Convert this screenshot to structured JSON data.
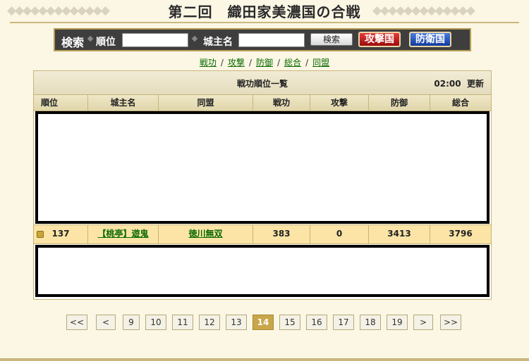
{
  "page": {
    "title": "第二回　織田家美濃国の合戦"
  },
  "search": {
    "heading": "検索",
    "rank_label": "順位",
    "rank_value": "",
    "lord_label": "城主名",
    "lord_value": "",
    "search_button": "検索",
    "attack_country": "攻撃国",
    "defense_country": "防衛国"
  },
  "categories": {
    "items": [
      "戦功",
      "攻撃",
      "防御",
      "総合",
      "同盟"
    ],
    "separator": "/"
  },
  "table": {
    "title": "戦功順位一覧",
    "time": "02:00",
    "refresh": "更新",
    "columns": [
      "順位",
      "城主名",
      "同盟",
      "戦功",
      "攻撃",
      "防御",
      "総合"
    ],
    "highlight_row": {
      "rank": "137",
      "lord": "【桃亭】遊鬼",
      "alliance": "徳川無双",
      "merit": "383",
      "attack": "0",
      "defense": "3413",
      "total": "3796"
    }
  },
  "pagination": {
    "first": "<<",
    "prev": "<",
    "pages": [
      "9",
      "10",
      "11",
      "12",
      "13",
      "14",
      "15",
      "16",
      "17",
      "18",
      "19"
    ],
    "active": "14",
    "next": ">",
    "last": ">>"
  },
  "colors": {
    "background": "#fbf7e4",
    "highlight_row": "#fbe4a6",
    "active_page": "#c9a64a",
    "attack_red": "#c41a1a",
    "defense_blue": "#2558c4",
    "link_green": "#0a6a00"
  }
}
